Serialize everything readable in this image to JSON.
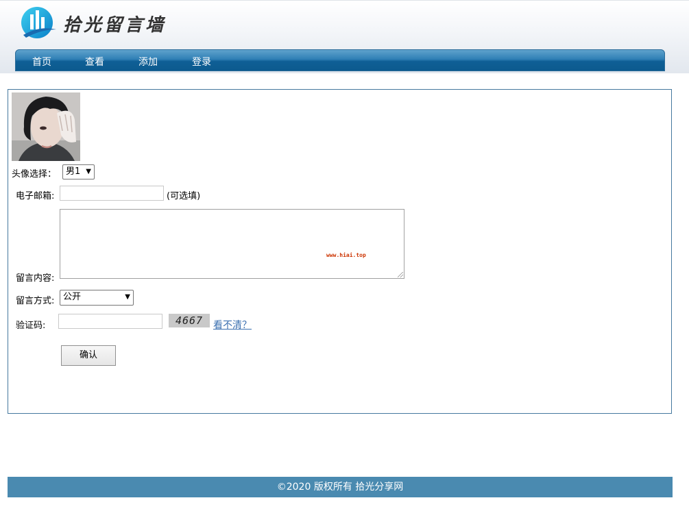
{
  "site": {
    "logo_text": "拾光留言墙"
  },
  "nav": {
    "items": [
      "首页",
      "查看",
      "添加",
      "登录"
    ]
  },
  "form": {
    "avatar_label": "头像选择：",
    "avatar_value": "男1",
    "email_label": "电子邮箱:",
    "email_value": "",
    "email_hint": "(可选填)",
    "content_label": "留言内容:",
    "content_value": "",
    "content_watermark": "www.hiai.top",
    "visibility_label": "留言方式:",
    "visibility_value": "公开",
    "captcha_label": "验证码:",
    "captcha_value": "",
    "captcha_image_text": "4667",
    "captcha_refresh": "看不清？",
    "submit_label": "确认"
  },
  "footer": {
    "text": "©2020 版权所有 拾光分享网"
  },
  "colors": {
    "nav_bg": "#0f5f96",
    "border": "#44789e",
    "footer_bg": "#4a8ab0",
    "link": "#3a6fb0"
  }
}
